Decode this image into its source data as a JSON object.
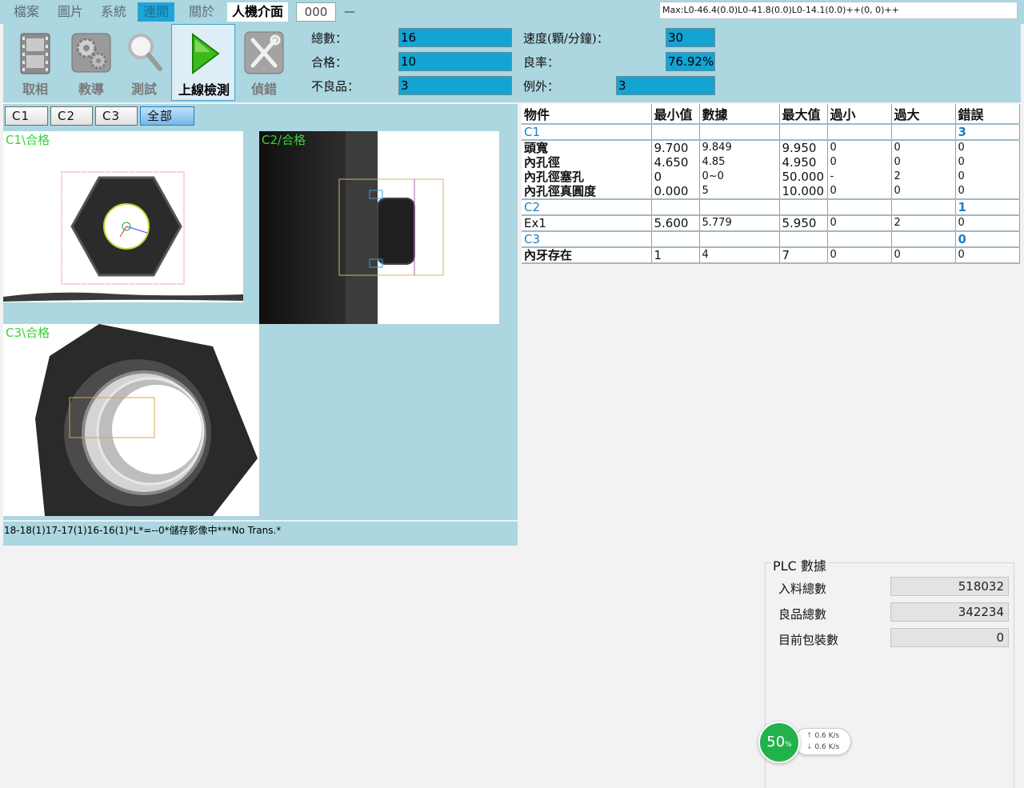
{
  "menu": {
    "items": [
      "檔案",
      "圖片",
      "系統",
      "連開",
      "關於"
    ],
    "active_index": 3,
    "hmi_tab": "人機介面",
    "code": "000",
    "dash": "—",
    "max_readout": "Max:L0-46.4(0.0)L0-41.8(0.0)L0-14.1(0.0)++(0, 0)++"
  },
  "toolbar": {
    "capture": "取相",
    "teach": "教導",
    "test": "測試",
    "online": "上線檢測",
    "debug": "偵錯"
  },
  "stats": {
    "total_label": "總數：",
    "total": "16",
    "pass_label": "合格：",
    "pass": "10",
    "defect_label": "不良品：",
    "defect": "3",
    "speed_label": "速度(顆/分鐘)：",
    "speed": "30",
    "yield_label": "良率：",
    "yield": "76.92%",
    "exception_label": "例外：",
    "exception": "3"
  },
  "cameras": {
    "buttons": [
      "C1",
      "C2",
      "C3",
      "全部"
    ],
    "active_index": 3,
    "c1_caption": "C1\\合格",
    "c2_caption": "C2/合格",
    "c3_caption": "C3\\合格"
  },
  "status_line": "18-18(1)17-17(1)16-16(1)*L*=--0*儲存影像中***No Trans.*",
  "results": {
    "headers": [
      "物件",
      "最小值",
      "數據",
      "最大值",
      "過小",
      "過大",
      "錯誤"
    ],
    "groups": [
      {
        "name": "C1",
        "errors": "3",
        "rows": [
          [
            "頭寬",
            "9.700",
            "9.849",
            "9.950",
            "0",
            "0",
            "0"
          ],
          [
            "內孔徑",
            "4.650",
            "4.85",
            "4.950",
            "0",
            "0",
            "0"
          ],
          [
            "內孔徑塞孔",
            "0",
            "0~0",
            "50.000",
            "-",
            "2",
            "0"
          ],
          [
            "內孔徑真圓度",
            "0.000",
            "5",
            "10.000",
            "0",
            "0",
            "0"
          ]
        ]
      },
      {
        "name": "C2",
        "errors": "1",
        "rows": [
          [
            "Ex1",
            "5.600",
            "5.779",
            "5.950",
            "0",
            "2",
            "0"
          ]
        ]
      },
      {
        "name": "C3",
        "errors": "0",
        "rows": [
          [
            "內牙存在",
            "1",
            "4",
            "7",
            "0",
            "0",
            "0"
          ]
        ]
      }
    ]
  },
  "plc": {
    "title": "PLC 數據",
    "feed_label": "入料總數",
    "feed": "518032",
    "good_label": "良品總數",
    "good": "342234",
    "pack_label": "目前包裝數",
    "pack": "0"
  },
  "network": {
    "percent": "50",
    "percent_sign": "%",
    "up": "0.6 K/s",
    "down": "0.6 K/s"
  },
  "colors": {
    "panel": "#acd6e0",
    "value_box": "#13a4d3",
    "pass_green": "#3ad13a",
    "group_blue": "#1e7fc0"
  }
}
